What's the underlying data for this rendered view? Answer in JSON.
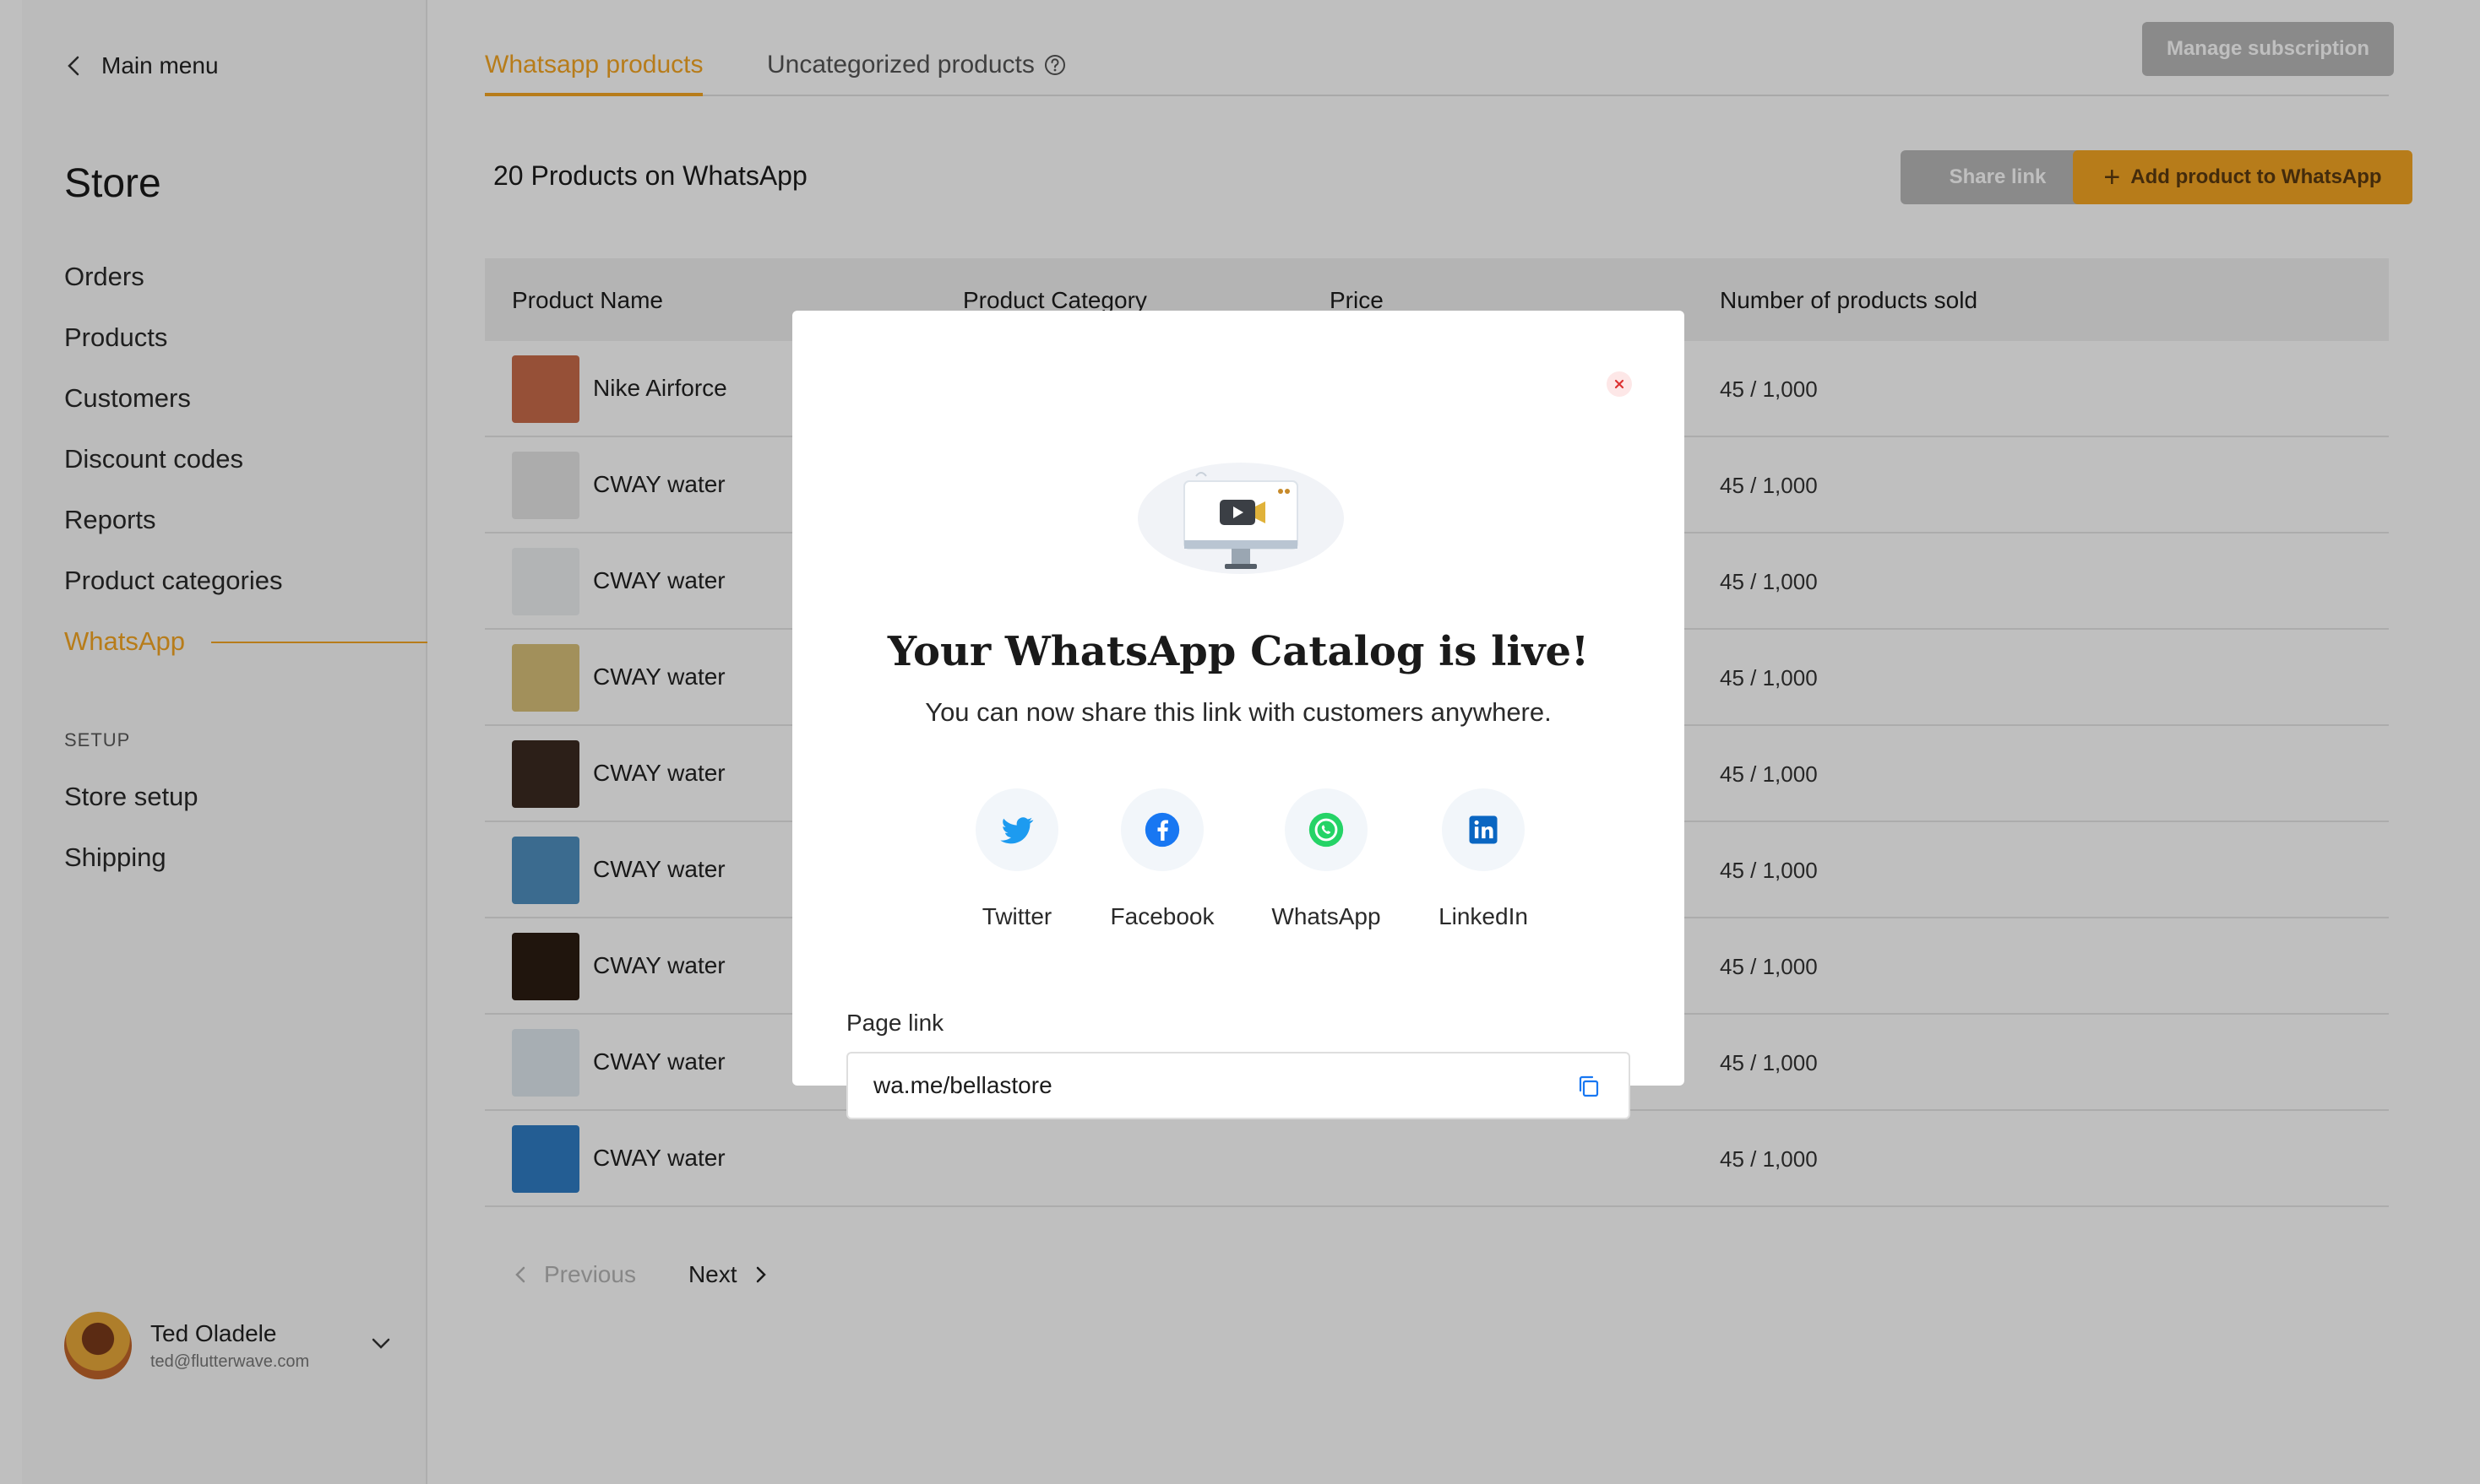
{
  "sidebar": {
    "back_label": "Main menu",
    "store_title": "Store",
    "items": [
      {
        "label": "Orders"
      },
      {
        "label": "Products"
      },
      {
        "label": "Customers"
      },
      {
        "label": "Discount codes"
      },
      {
        "label": "Reports"
      },
      {
        "label": "Product categories"
      },
      {
        "label": "WhatsApp",
        "active": true
      }
    ],
    "setup_label": "SETUP",
    "setup_items": [
      {
        "label": "Store setup"
      },
      {
        "label": "Shipping"
      }
    ],
    "user": {
      "name": "Ted Oladele",
      "email": "ted@flutterwave.com"
    }
  },
  "tabs": [
    {
      "label": "Whatsapp products",
      "active": true
    },
    {
      "label": "Uncategorized products",
      "icon": "help-circle-icon"
    }
  ],
  "header": {
    "manage_label": "Manage subscription",
    "count_title": "20 Products on WhatsApp",
    "share_label": "Share link",
    "add_label": "Add product to WhatsApp"
  },
  "table": {
    "columns": [
      "Product Name",
      "Product Category",
      "Price",
      "Number of products sold"
    ],
    "rows": [
      {
        "name": "Nike Airforce",
        "sold": "45 / 1,000",
        "thumb": "#c86b4a"
      },
      {
        "name": "CWAY water",
        "sold": "45 / 1,000",
        "thumb": "#e6e6e6"
      },
      {
        "name": "CWAY water",
        "sold": "45 / 1,000",
        "thumb": "#eef0f2"
      },
      {
        "name": "CWAY water",
        "sold": "45 / 1,000",
        "thumb": "#d9c07a"
      },
      {
        "name": "CWAY water",
        "sold": "45 / 1,000",
        "thumb": "#3b2a20"
      },
      {
        "name": "CWAY water",
        "sold": "45 / 1,000",
        "thumb": "#4f8fbf"
      },
      {
        "name": "CWAY water",
        "sold": "45 / 1,000",
        "thumb": "#2b1c12"
      },
      {
        "name": "CWAY water",
        "sold": "45 / 1,000",
        "thumb": "#dfe8ef"
      },
      {
        "name": "CWAY water",
        "sold": "45 / 1,000",
        "thumb": "#2f7cc4"
      }
    ]
  },
  "pagination": {
    "prev_label": "Previous",
    "next_label": "Next"
  },
  "modal": {
    "title": "Your WhatsApp Catalog is live!",
    "subtitle": "You can now share this link with customers anywhere.",
    "socials": [
      {
        "label": "Twitter",
        "icon": "twitter-icon",
        "color": "#1d9bf0"
      },
      {
        "label": "Facebook",
        "icon": "facebook-icon",
        "color": "#1877f2"
      },
      {
        "label": "WhatsApp",
        "icon": "whatsapp-icon",
        "color": "#25d366"
      },
      {
        "label": "LinkedIn",
        "icon": "linkedin-icon",
        "color": "#0a66c2"
      }
    ],
    "link_label": "Page link",
    "link_value": "wa.me/bellastore"
  },
  "colors": {
    "accent": "#f5a623",
    "overlay": "rgba(0,0,0,0.25)"
  }
}
